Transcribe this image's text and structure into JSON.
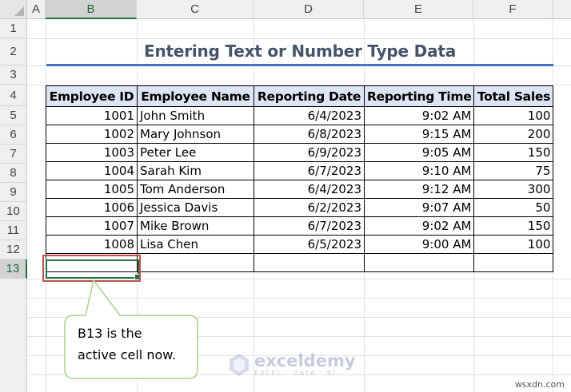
{
  "columns": [
    "A",
    "B",
    "C",
    "D",
    "E",
    "F"
  ],
  "rows": [
    "1",
    "2",
    "3",
    "4",
    "5",
    "6",
    "7",
    "8",
    "9",
    "10",
    "11",
    "12",
    "13"
  ],
  "title": "Entering Text or Number Type Data",
  "table": {
    "headers": [
      "Employee ID",
      "Employee Name",
      "Reporting Date",
      "Reporting Time",
      "Total Sales"
    ],
    "rows": [
      [
        "1001",
        "John Smith",
        "6/4/2023",
        "9:02 AM",
        "100"
      ],
      [
        "1002",
        "Mary Johnson",
        "6/8/2023",
        "9:15 AM",
        "200"
      ],
      [
        "1003",
        "Peter Lee",
        "6/9/2023",
        "9:05 AM",
        "150"
      ],
      [
        "1004",
        "Sarah Kim",
        "6/7/2023",
        "9:10 AM",
        "75"
      ],
      [
        "1005",
        "Tom Anderson",
        "6/4/2023",
        "9:12 AM",
        "300"
      ],
      [
        "1006",
        "Jessica Davis",
        "6/2/2023",
        "9:07 AM",
        "50"
      ],
      [
        "1007",
        "Mike Brown",
        "6/7/2023",
        "9:02 AM",
        "150"
      ],
      [
        "1008",
        "Lisa Chen",
        "6/5/2023",
        "9:00 AM",
        "100"
      ]
    ]
  },
  "callout": {
    "line1": "B13 is the",
    "line2": "active cell now."
  },
  "watermark": {
    "name": "exceldemy",
    "tagline": "EXCEL · DATA · BI"
  },
  "brand": "wsxdn.com",
  "colors": {
    "accent": "#217346",
    "header_fill": "#dde5f4",
    "title_color": "#44546a",
    "title_line": "#4472c4",
    "callout_border": "#a9d18e",
    "highlight_border": "#c0504d"
  }
}
